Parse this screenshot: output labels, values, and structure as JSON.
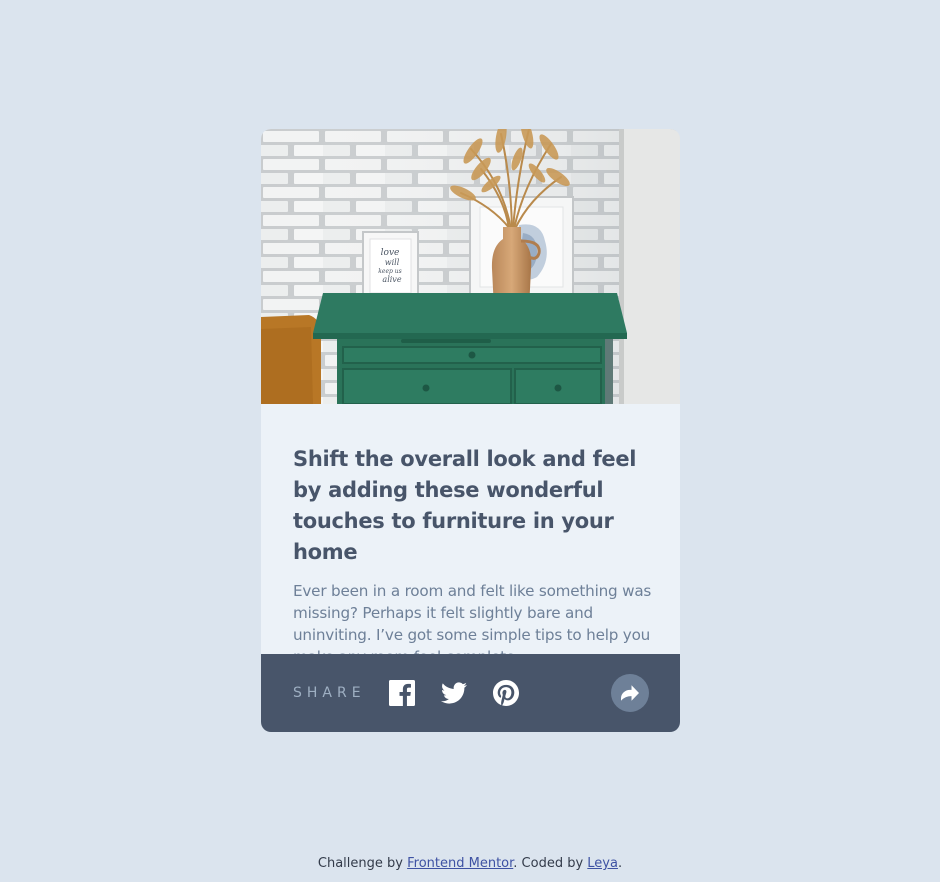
{
  "card": {
    "image_alt": "drawers",
    "title": "Shift the overall look and feel by adding these wonderful touches to furniture in your home",
    "description": "Ever been in a room and felt like something was missing? Perhaps it felt slightly bare and uninviting. I’ve got some simple tips to help you make any room feel complete.",
    "frame_text": [
      "love",
      "will",
      "keep us",
      "alive"
    ]
  },
  "share": {
    "label": "SHARE",
    "icons": [
      "facebook-icon",
      "twitter-icon",
      "pinterest-icon",
      "share-arrow-icon"
    ]
  },
  "attribution": {
    "prefix": "Challenge by ",
    "challenge_link": "Frontend Mentor",
    "middle": ". Coded by ",
    "author_link": "Leya",
    "suffix": "."
  },
  "colors": {
    "page_bg": "#dbe4ee",
    "card_body_bg": "#ecf2f8",
    "title": "#48556a",
    "description": "#6e8098",
    "share_bar_bg": "#48556a",
    "share_button_bg": "#6e8098",
    "link": "#3e52a3"
  }
}
